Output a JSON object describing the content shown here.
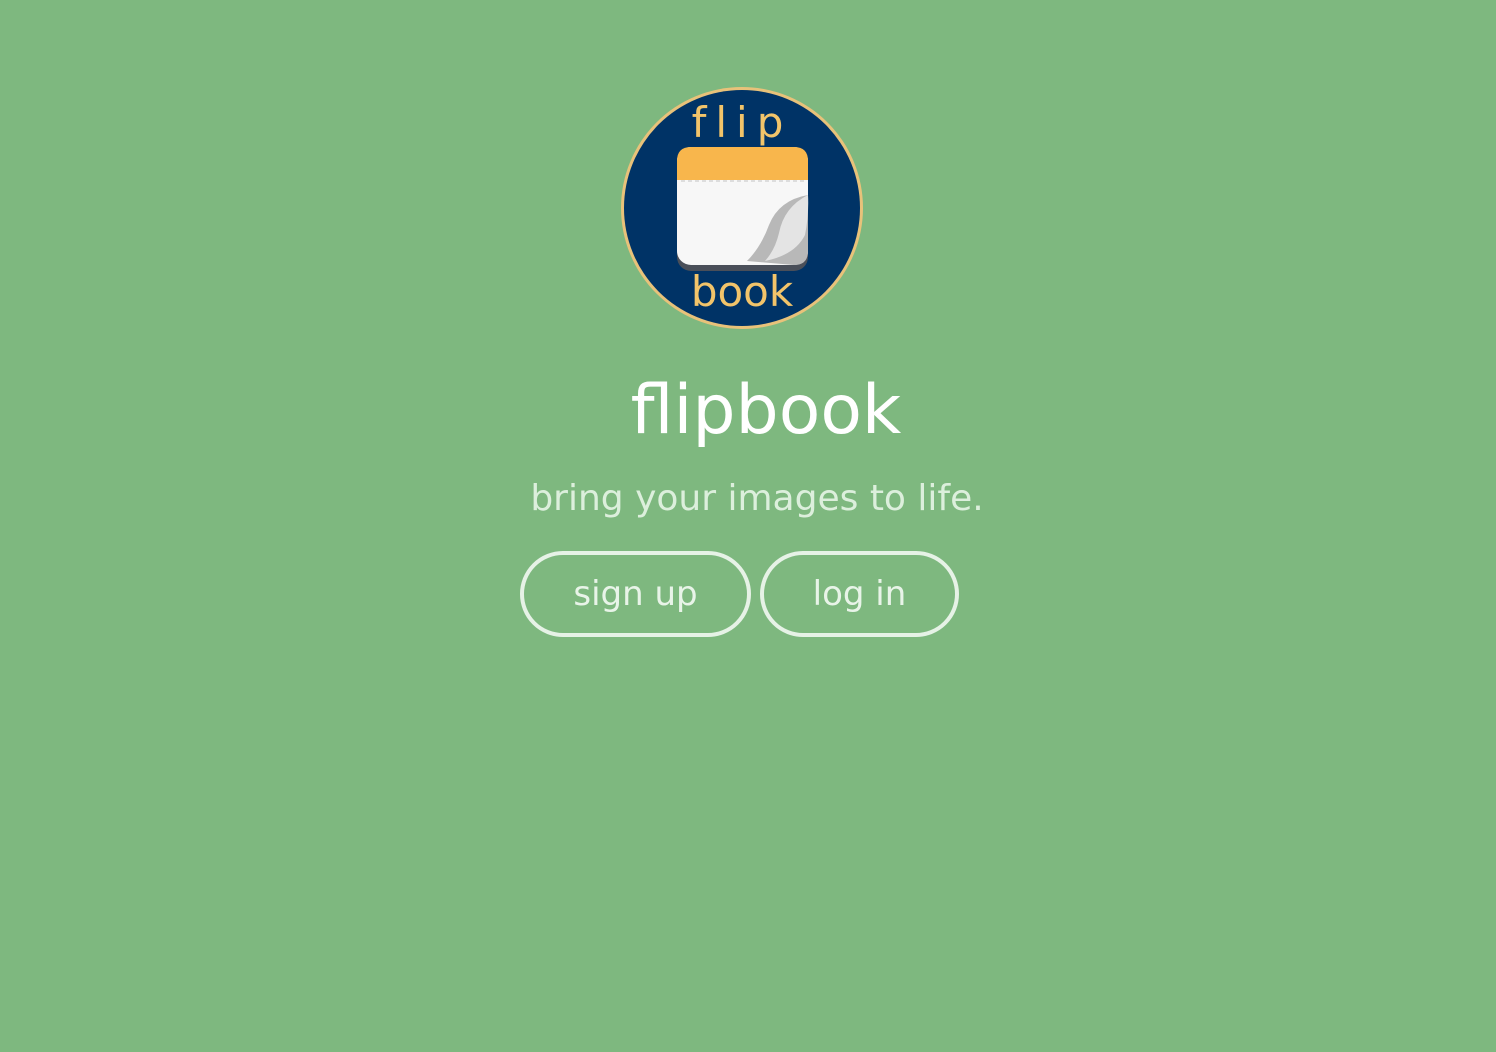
{
  "logo": {
    "top_text": "flip",
    "bottom_text": "book",
    "colors": {
      "circle": "#003366",
      "ring": "#e8c27a",
      "text": "#f2c46a",
      "tab": "#f8b64c",
      "page": "#ffffff"
    }
  },
  "app": {
    "title": "flipbook",
    "tagline": "bring your images to life."
  },
  "actions": {
    "signup_label": "sign up",
    "login_label": "log in"
  },
  "theme": {
    "background": "#7eb87f",
    "title_color": "#ffffff",
    "tagline_color": "#dcefdc",
    "button_border": "#e6f2e6"
  }
}
